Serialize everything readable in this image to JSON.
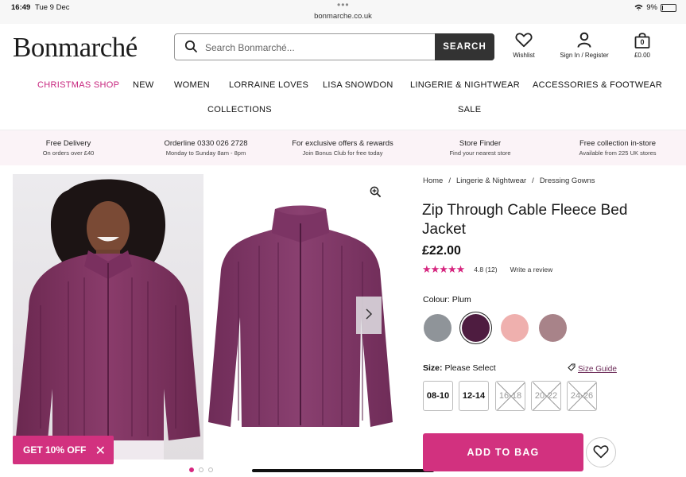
{
  "status_bar": {
    "time": "16:49",
    "date": "Tue 9 Dec",
    "url": "bonmarche.co.uk",
    "battery": "9%"
  },
  "header": {
    "logo": "Bonmarché",
    "search": {
      "placeholder": "Search Bonmarché...",
      "button": "SEARCH"
    },
    "wishlist": "Wishlist",
    "account": "Sign In / Register",
    "bag_total": "£0.00",
    "bag_count": "0"
  },
  "nav": {
    "row1": [
      "CHRISTMAS SHOP",
      "NEW",
      "WOMEN",
      "LORRAINE LOVES",
      "LISA SNOWDON",
      "LINGERIE & NIGHTWEAR",
      "ACCESSORIES & FOOTWEAR"
    ],
    "row2": [
      "COLLECTIONS",
      "SALE"
    ]
  },
  "benefits": [
    {
      "title": "Free Delivery",
      "sub": "On orders over £40"
    },
    {
      "title": "Orderline 0330 026 2728",
      "sub": "Monday to Sunday 8am - 8pm"
    },
    {
      "title": "For exclusive offers & rewards",
      "sub": "Join Bonus Club for free today"
    },
    {
      "title": "Store Finder",
      "sub": "Find your nearest store"
    },
    {
      "title": "Free collection in-store",
      "sub": "Available from 225 UK stores"
    }
  ],
  "gallery": {
    "image_count": 3,
    "active_index": 0
  },
  "promo": {
    "label": "GET 10% OFF"
  },
  "product": {
    "breadcrumb": [
      "Home",
      "Lingerie & Nightwear",
      "Dressing Gowns"
    ],
    "title": "Zip Through Cable Fleece Bed Jacket",
    "price": "£22.00",
    "rating_value": 4.8,
    "rating_text": "4.8",
    "review_count": "(12)",
    "write_review": "Write a review",
    "colour_label": "Colour:",
    "colour_selected": "Plum",
    "colours": [
      {
        "name": "Grey",
        "hex": "#8f9499",
        "selected": false
      },
      {
        "name": "Plum",
        "hex": "#4e1c40",
        "selected": true
      },
      {
        "name": "Pink",
        "hex": "#efb0ae",
        "selected": false
      },
      {
        "name": "Mauve",
        "hex": "#a88389",
        "selected": false
      }
    ],
    "size_label": "Size:",
    "size_prompt": "Please Select",
    "size_guide": "Size Guide",
    "sizes": [
      {
        "label": "08-10",
        "available": true
      },
      {
        "label": "12-14",
        "available": true
      },
      {
        "label": "16-18",
        "available": false
      },
      {
        "label": "20-22",
        "available": false
      },
      {
        "label": "24-26",
        "available": false
      }
    ],
    "add_to_bag": "ADD TO BAG"
  },
  "colors": {
    "brand_pink": "#d2317f",
    "dark": "#333333",
    "benefit_bg": "#fbf3f7",
    "plum": "#7b2e5c"
  }
}
